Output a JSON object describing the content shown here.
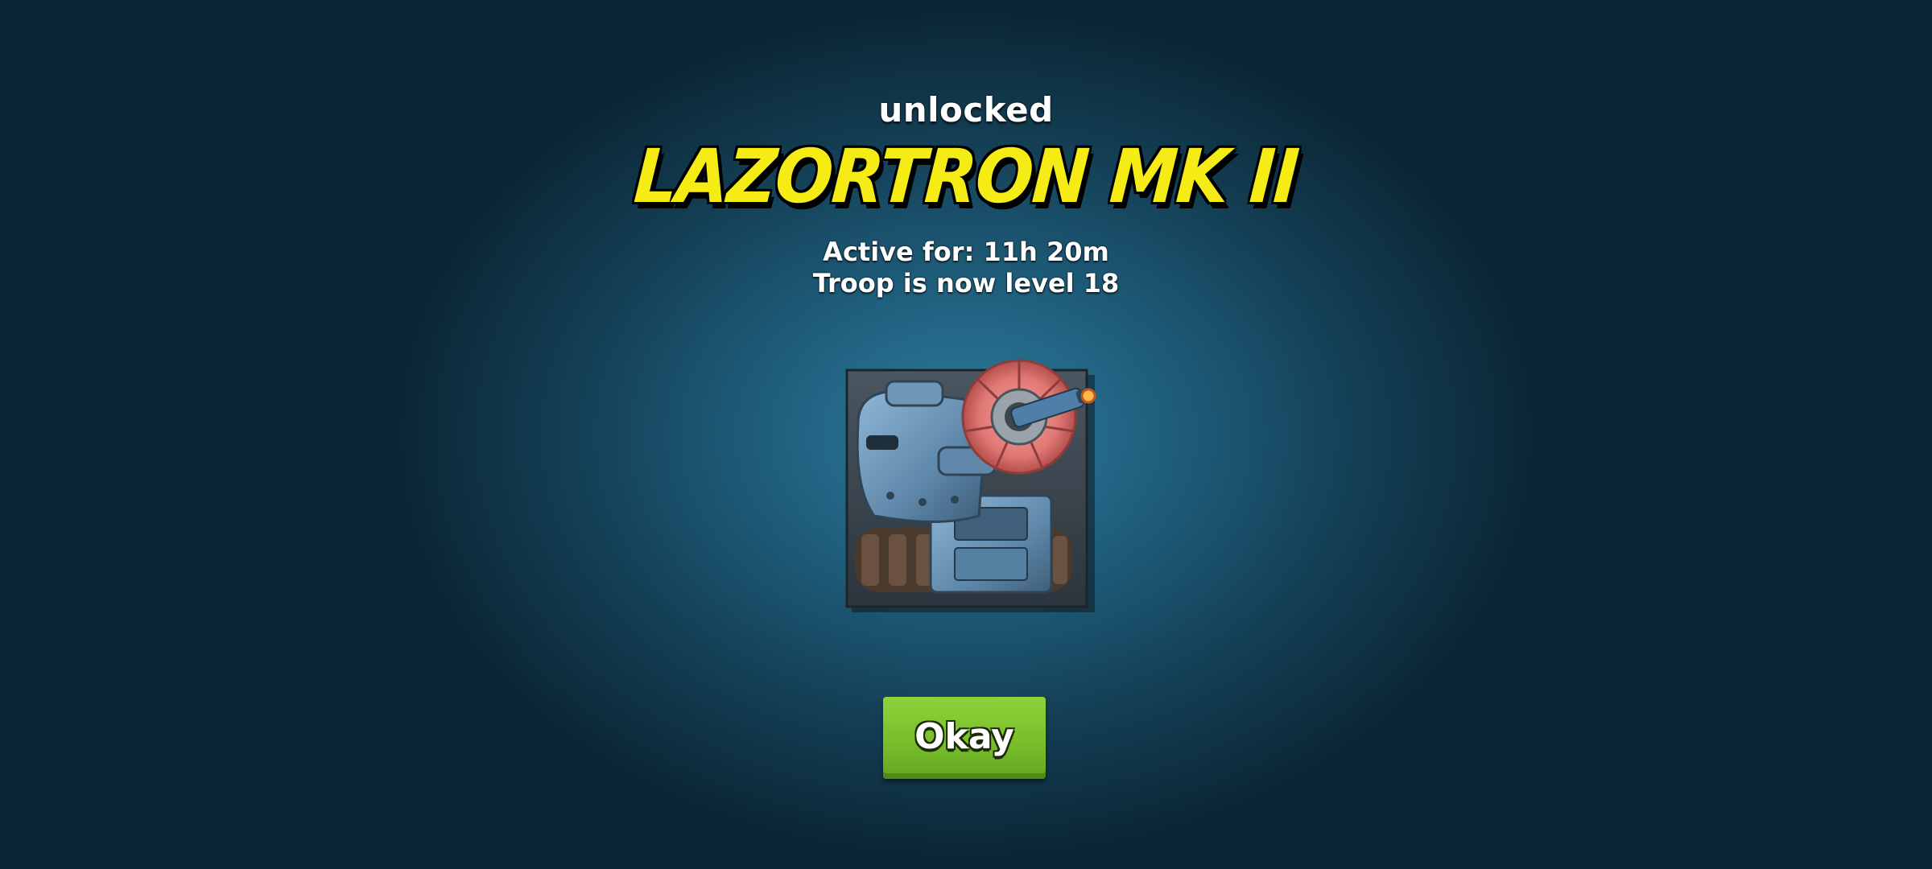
{
  "popup": {
    "heading": "unlocked",
    "troop_name": "LAZORTRON MK II",
    "active_for": "Active for: 11h 20m",
    "level_text": "Troop is now level 18",
    "portrait_icon": "lazortron-tank-icon",
    "okay_label": "Okay"
  },
  "colors": {
    "troop_name": "#f6ec15",
    "okay_button": "#7dc42f",
    "background_center": "#2f7b9c",
    "background_edge": "#0b2736"
  }
}
